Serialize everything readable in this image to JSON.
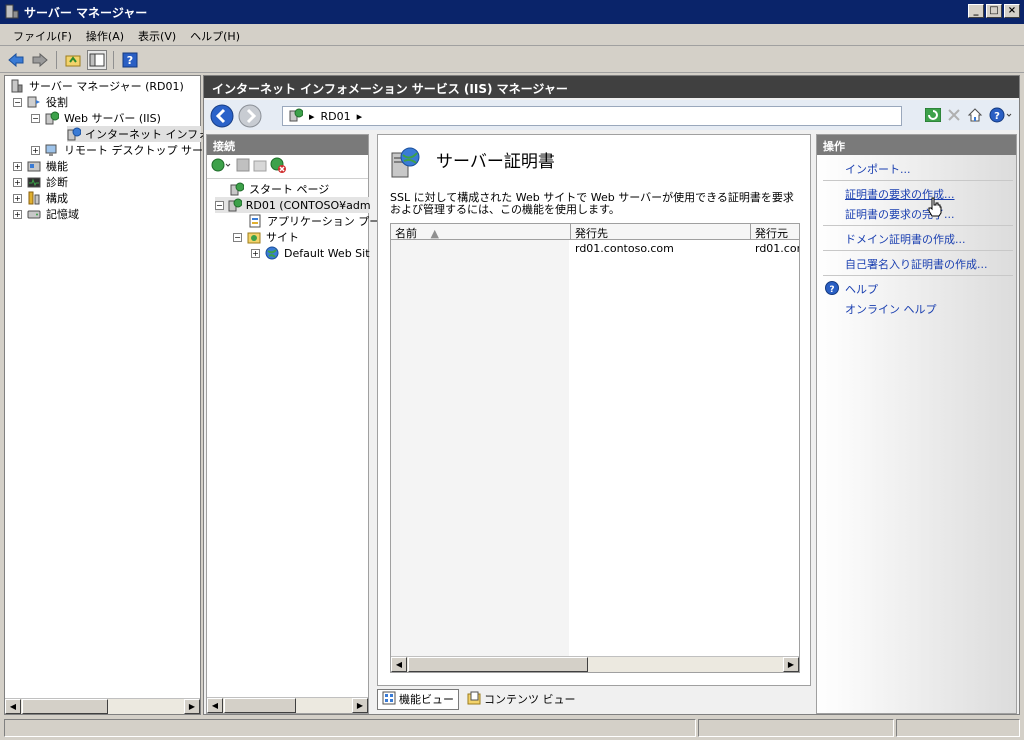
{
  "window": {
    "title": "サーバー マネージャー"
  },
  "menubar": [
    "ファイル(F)",
    "操作(A)",
    "表示(V)",
    "ヘルプ(H)"
  ],
  "left_tree": {
    "root": "サーバー マネージャー (RD01)",
    "roles": "役割",
    "web_server": "Web サーバー (IIS)",
    "iis_manager": "インターネット インフォメー",
    "rds": "リモート デスクトップ サービス",
    "features": "機能",
    "diagnostics": "診断",
    "configuration": "構成",
    "storage": "記憶域"
  },
  "iis": {
    "header": "インターネット インフォメーション サービス (IIS) マネージャー",
    "address": "RD01"
  },
  "connections": {
    "title": "接続",
    "items": [
      "スタート ページ",
      "RD01 (CONTOSO¥adm",
      "アプリケーション プール",
      "サイト",
      "Default Web Sit"
    ]
  },
  "feature": {
    "title": "サーバー証明書",
    "description": "SSL に対して構成された Web サイトで Web サーバーが使用できる証明書を要求および管理するには、この機能を使用します。",
    "columns": [
      "名前",
      "発行先",
      "発行元"
    ],
    "rows": [
      {
        "name": "",
        "issued_to": "rd01.contoso.com",
        "issued_by": "rd01.con"
      }
    ]
  },
  "view_tabs": [
    "機能ビュー",
    "コンテンツ ビュー"
  ],
  "actions": {
    "title": "操作",
    "items": [
      "インポート...",
      "証明書の要求の作成...",
      "証明書の要求の完了...",
      "ドメイン証明書の作成...",
      "自己署名入り証明書の作成...",
      "ヘルプ",
      "オンライン ヘルプ"
    ]
  }
}
